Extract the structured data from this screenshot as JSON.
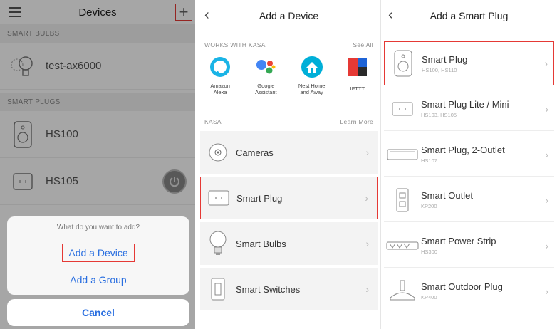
{
  "panel1": {
    "title": "Devices",
    "sections": {
      "bulbs": "SMART BULBS",
      "plugs": "SMART PLUGS"
    },
    "devices": {
      "bulb": "test-ax6000",
      "plug1": "HS100",
      "plug2": "HS105"
    },
    "sheet": {
      "prompt": "What do you want to add?",
      "add_device": "Add a Device",
      "add_group": "Add a Group",
      "cancel": "Cancel"
    }
  },
  "panel2": {
    "title": "Add a Device",
    "works_with": "WORKS WITH KASA",
    "see_all": "See All",
    "partners": [
      {
        "label": "Amazon\nAlexa"
      },
      {
        "label": "Google\nAssistant"
      },
      {
        "label": "Nest Home\nand Away"
      },
      {
        "label": "IFTTT"
      }
    ],
    "kasa": "KASA",
    "learn_more": "Learn More",
    "categories": [
      {
        "label": "Cameras"
      },
      {
        "label": "Smart Plug"
      },
      {
        "label": "Smart Bulbs"
      },
      {
        "label": "Smart Switches"
      }
    ]
  },
  "panel3": {
    "title": "Add a Smart Plug",
    "products": [
      {
        "name": "Smart Plug",
        "models": "HS100, HS110"
      },
      {
        "name": "Smart Plug Lite / Mini",
        "models": "HS103, HS105"
      },
      {
        "name": "Smart Plug, 2-Outlet",
        "models": "HS107"
      },
      {
        "name": "Smart Outlet",
        "models": "KP200"
      },
      {
        "name": "Smart Power Strip",
        "models": "HS300"
      },
      {
        "name": "Smart Outdoor Plug",
        "models": "KP400"
      }
    ]
  },
  "colors": {
    "highlight": "#e53935",
    "link_blue": "#2a6fe0"
  }
}
